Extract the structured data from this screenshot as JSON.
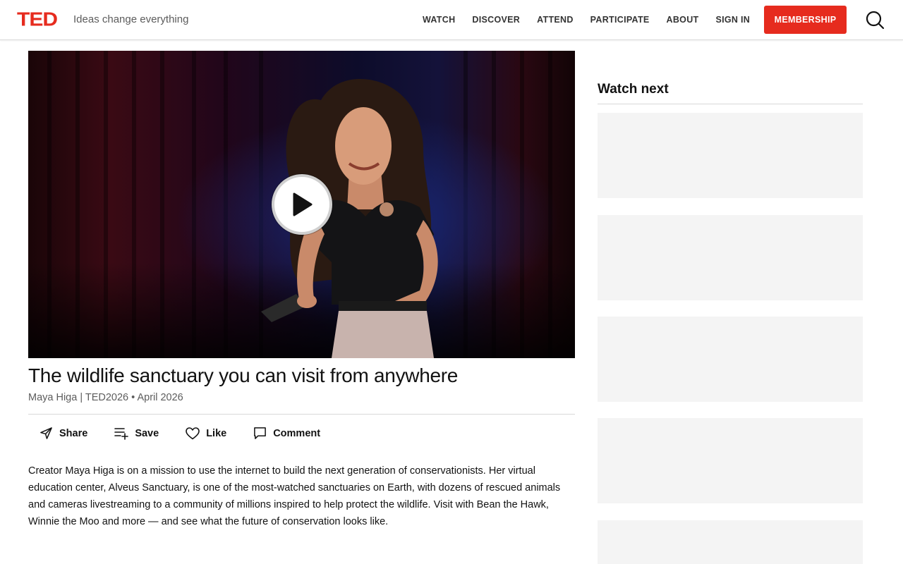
{
  "header": {
    "logo": "TED",
    "tagline": "Ideas change everything",
    "nav": [
      "WATCH",
      "DISCOVER",
      "ATTEND",
      "PARTICIPATE",
      "ABOUT",
      "SIGN IN"
    ],
    "membership_label": "MEMBERSHIP",
    "brand_color": "#e62b1e"
  },
  "talk": {
    "title": "The wildlife sanctuary you can visit from anywhere",
    "meta": "Maya Higa | TED2026 • April 2026",
    "description": "Creator Maya Higa is on a mission to use the internet to build the next generation of conservationists. Her virtual education center, Alveus Sanctuary, is one of the most-watched sanctuaries on Earth, with dozens of rescued animals and cameras livestreaming to a community of millions inspired to help protect the wildlife. Visit with Bean the Hawk, Winnie the Moo and more — and see what the future of conservation looks like."
  },
  "actions": {
    "share": "Share",
    "save": "Save",
    "like": "Like",
    "comment": "Comment"
  },
  "sidebar": {
    "heading": "Watch next"
  },
  "icons": {
    "play": "play-icon",
    "search": "search-icon",
    "share": "send-icon",
    "save": "playlist-add-icon",
    "like": "heart-icon",
    "comment": "comment-icon"
  }
}
